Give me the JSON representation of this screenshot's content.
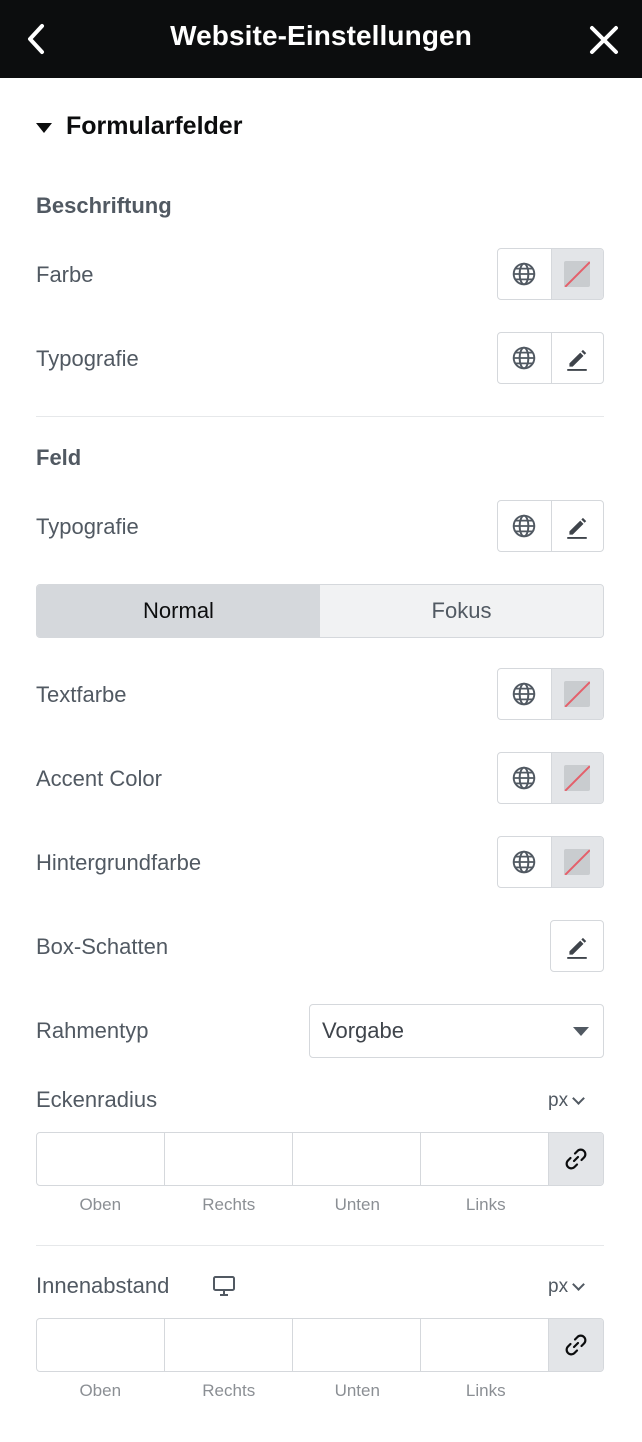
{
  "header": {
    "title": "Website-Einstellungen",
    "back_icon": "chevron-left-icon",
    "close_icon": "close-icon"
  },
  "section": {
    "title": "Formularfelder",
    "expanded": true
  },
  "label_group": {
    "heading": "Beschriftung",
    "color_label": "Farbe",
    "typography_label": "Typografie"
  },
  "field_group": {
    "heading": "Feld",
    "typography_label": "Typografie",
    "tabs": [
      {
        "label": "Normal",
        "active": true
      },
      {
        "label": "Fokus",
        "active": false
      }
    ],
    "text_color_label": "Textfarbe",
    "accent_color_label": "Accent Color",
    "background_color_label": "Hintergrundfarbe",
    "box_shadow_label": "Box-Schatten",
    "border_type_label": "Rahmentyp",
    "border_type_value": "Vorgabe",
    "corner_radius_label": "Eckenradius",
    "corner_radius_unit": "px",
    "padding_label": "Innenabstand",
    "padding_unit": "px",
    "dimension_labels": [
      "Oben",
      "Rechts",
      "Unten",
      "Links"
    ]
  },
  "colors": {
    "header_bg": "#0c0d0e",
    "border": "#d5d8dc",
    "active_tab": "#d5d8dc",
    "swatch_strike": "#e4606a"
  }
}
